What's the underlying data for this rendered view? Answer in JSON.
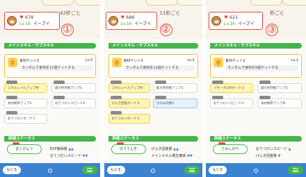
{
  "panels": [
    {
      "time_text": "42秒ごと",
      "cp": "678",
      "level": "Lv.16",
      "name": "イーブイ",
      "badge": "①",
      "section_title": "メインスキル・サブスキル",
      "skill_name": "食材ゲットS",
      "skill_level": "Lv.3",
      "skill_desc": "ランダムで食材を11個ゲットする",
      "chips": [
        "スキルレベルアップM",
        "最大所持数アップS",
        "食材確率アップS",
        "おてつだいスピードS",
        "おてつだいボーナス"
      ],
      "stats_title": "詳細ステータス",
      "nature": "おくびょう",
      "stat1": "EXP獲得量",
      "stat2": "おてつだいスピード"
    },
    {
      "time_text": "11秒ごと",
      "cp": "686",
      "level": "Lv.16",
      "name": "イーブイ",
      "badge": "②",
      "section_title": "メインスキル・サブスキル",
      "skill_name": "食材ゲットS",
      "skill_level": "Lv.3",
      "skill_desc": "ランダムで食材を11個ゲットする",
      "chips": [
        "スキルレベルアップM",
        "最大所持数アップS",
        "げんき回復ボーナス",
        "きのみの数S",
        "おてつだいボーナス"
      ],
      "stats_title": "詳細ステータス",
      "nature": "のうてんき",
      "stat1": "げんき回復量",
      "stat2": "メインスキル発生確率"
    },
    {
      "time_text": "秒ごと",
      "cp": "621",
      "level": "Lv.16",
      "name": "イーブイ",
      "badge": "③",
      "section_title": "メインスキル・サブスキル",
      "skill_name": "食材ゲットS",
      "skill_level": "Lv.1",
      "skill_desc": "ランダムで食材を6個ゲットする",
      "chips": [
        "リサーチEXPボーナス",
        "最大所持数アップS",
        "おてつだいスピードS",
        "食材確率アップM"
      ],
      "stats_title": "詳細ステータス",
      "nature": "さみしがり",
      "stat1": "おてつだいスピード",
      "stat2": "げんき回復量"
    }
  ],
  "bottom": {
    "back_label": "もどる"
  }
}
